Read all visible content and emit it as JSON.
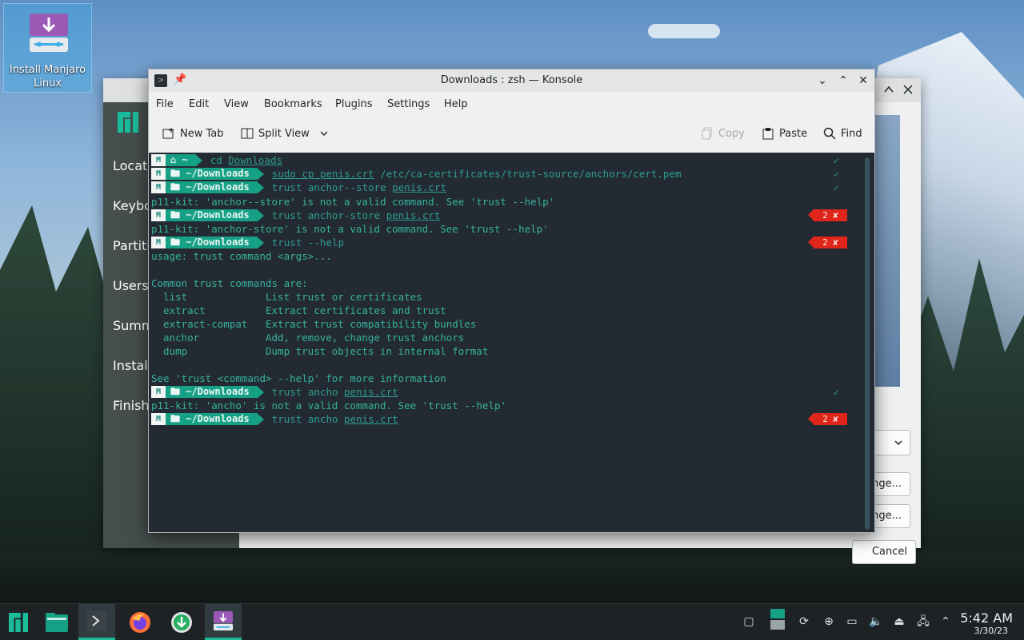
{
  "desktop": {
    "icon_label": "Install Manjaro Linux"
  },
  "installer": {
    "steps": [
      "Locati",
      "Keybo",
      "Partiti",
      "Users",
      "Summ",
      "Install",
      "Finish"
    ],
    "buttons": {
      "change1": "nge...",
      "change2": "nge...",
      "cancel": "Cancel"
    }
  },
  "konsole": {
    "title": "Downloads : zsh — Konsole",
    "menu": [
      "File",
      "Edit",
      "View",
      "Bookmarks",
      "Plugins",
      "Settings",
      "Help"
    ],
    "toolbar": {
      "new_tab": "New Tab",
      "split_view": "Split View",
      "copy": "Copy",
      "paste": "Paste",
      "find": "Find"
    }
  },
  "terminal": {
    "prompts": [
      {
        "dir": "~",
        "cmd_pre": "cd ",
        "cmd_link": "Downloads",
        "cmd_post": "",
        "status": "✓"
      },
      {
        "dir": "~/Downloads",
        "cmd_pre": "sudo cp ",
        "cmd_link": "penis.crt",
        "cmd_post": " /etc/ca-certificates/trust-source/anchors/cert.pem",
        "status": "✓"
      },
      {
        "dir": "~/Downloads",
        "cmd_pre": "trust anchor--store ",
        "cmd_link": "penis.crt",
        "cmd_post": "",
        "status": "✓"
      },
      {
        "dir": "~/Downloads",
        "cmd_pre": "trust anchor-store ",
        "cmd_link": "penis.crt",
        "cmd_post": "",
        "status": "2 ✘"
      },
      {
        "dir": "~/Downloads",
        "cmd_pre": "trust --help",
        "cmd_link": "",
        "cmd_post": "",
        "status": "2 ✘"
      },
      {
        "dir": "~/Downloads",
        "cmd_pre": "trust ancho ",
        "cmd_link": "penis.crt",
        "cmd_post": "",
        "status": "✓"
      },
      {
        "dir": "~/Downloads",
        "cmd_pre": "trust ancho ",
        "cmd_link": "penis.crt",
        "cmd_post": "",
        "status": "2 ✘"
      }
    ],
    "output": {
      "err1": "p11-kit: 'anchor--store' is not a valid command. See 'trust --help'",
      "err2": "p11-kit: 'anchor-store' is not a valid command. See 'trust --help'",
      "usage": "usage: trust command <args>...",
      "common": "Common trust commands are:",
      "commands": [
        "  list             List trust or certificates",
        "  extract          Extract certificates and trust",
        "  extract-compat   Extract trust compatibility bundles",
        "  anchor           Add, remove, change trust anchors",
        "  dump             Dump trust objects in internal format"
      ],
      "see": "See 'trust <command> --help' for more information",
      "err3": "p11-kit: 'ancho' is not a valid command. See 'trust --help'"
    }
  },
  "taskbar": {
    "time": "5:42 AM",
    "date": "3/30/23"
  },
  "colors": {
    "accent": "#16a085",
    "error": "#e0261b",
    "terminal_bg": "#232a33"
  }
}
